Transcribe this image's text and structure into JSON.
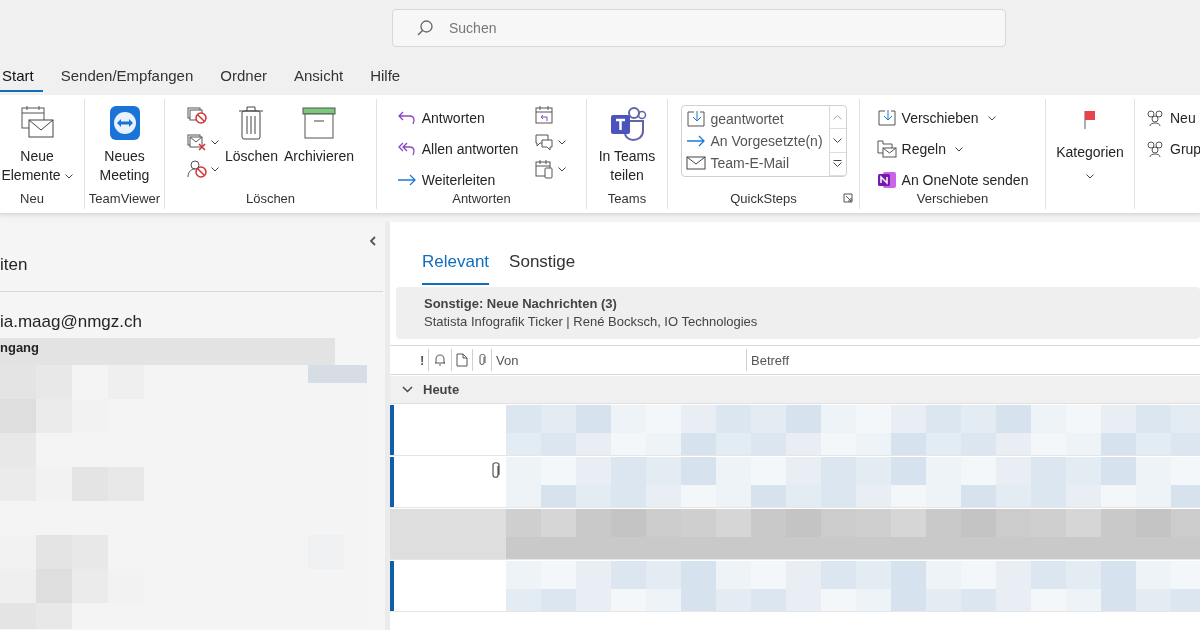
{
  "search": {
    "placeholder": "Suchen"
  },
  "tabs": [
    {
      "label": "Start",
      "selected": true
    },
    {
      "label": "Senden/Empfangen",
      "selected": false
    },
    {
      "label": "Ordner",
      "selected": false
    },
    {
      "label": "Ansicht",
      "selected": false
    },
    {
      "label": "Hilfe",
      "selected": false
    }
  ],
  "ribbon": {
    "groups": [
      {
        "label": "Neu",
        "buttons": [
          {
            "label": "Neue Elemente",
            "dropdown": true
          }
        ]
      },
      {
        "label": "TeamViewer",
        "buttons": [
          {
            "label": "Neues Meeting",
            "dropdown": false
          }
        ]
      },
      {
        "label": "Löschen",
        "small": [
          {
            "dropdown": false
          },
          {
            "dropdown": true
          },
          {
            "dropdown": true
          }
        ],
        "buttons": [
          {
            "label": "Löschen",
            "dropdown": false
          },
          {
            "label": "Archivieren",
            "dropdown": false
          }
        ]
      },
      {
        "label": "Antworten",
        "buttons": [
          {
            "label": "Antworten",
            "dropdown": false
          },
          {
            "label": "Allen antworten",
            "dropdown": false
          },
          {
            "label": "Weiterleiten",
            "dropdown": false
          }
        ],
        "small": [
          {
            "dropdown": false
          },
          {
            "dropdown": true
          },
          {
            "dropdown": true
          }
        ]
      },
      {
        "label": "Teams",
        "buttons": [
          {
            "label": "In Teams teilen",
            "dropdown": false
          }
        ]
      },
      {
        "label": "QuickSteps",
        "steps": [
          "geantwortet",
          "An Vorgesetzte(n)",
          "Team-E-Mail"
        ]
      },
      {
        "label": "Verschieben",
        "buttons": [
          {
            "label": "Verschieben",
            "dropdown": true
          },
          {
            "label": "Regeln",
            "dropdown": true
          },
          {
            "label": "An OneNote senden",
            "dropdown": false
          }
        ]
      },
      {
        "buttons": [
          {
            "label": "Kategorien",
            "dropdown": true
          }
        ]
      },
      {
        "buttons": [
          {
            "label": "Neu"
          },
          {
            "label": "Grup"
          }
        ]
      }
    ]
  },
  "folders": {
    "header": "iten",
    "account": "ia.maag@nmgz.ch",
    "items": [
      {
        "label": "ngang",
        "selected": true
      }
    ]
  },
  "mail": {
    "tabs": [
      {
        "label": "Relevant",
        "selected": true
      },
      {
        "label": "Sonstige",
        "selected": false
      }
    ],
    "notice": {
      "title": "Sonstige: Neue Nachrichten (3)",
      "text": "Statista Infografik Ticker | René Bocksch, IO Technologies"
    },
    "columns": {
      "importance": "!",
      "from": "Von",
      "subject": "Betreff"
    },
    "group": {
      "label": "Heute",
      "expanded": true
    },
    "rows": [
      {
        "unread": true,
        "selected": false,
        "attachment": false
      },
      {
        "unread": true,
        "selected": false,
        "attachment": true
      },
      {
        "unread": false,
        "selected": true,
        "attachment": false
      },
      {
        "unread": true,
        "selected": false,
        "attachment": false
      }
    ]
  }
}
